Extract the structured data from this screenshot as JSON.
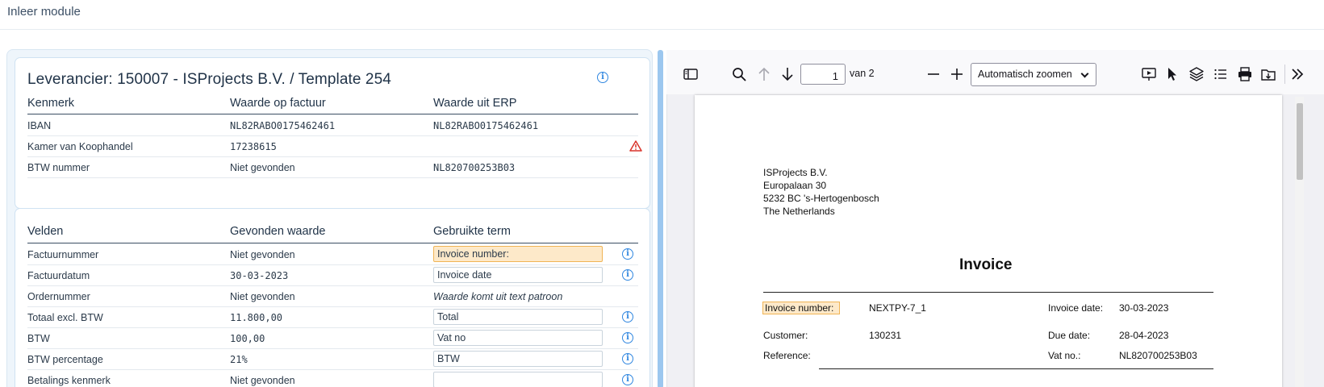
{
  "header": {
    "title": "Inleer module"
  },
  "supplier": {
    "title": "Leverancier: 150007 - ISProjects B.V. / Template 254",
    "columns": [
      "Kenmerk",
      "Waarde op factuur",
      "Waarde uit ERP"
    ],
    "rows": [
      {
        "label": "IBAN",
        "invoice": "NL82RABO0175462461",
        "erp": "NL82RABO0175462461",
        "warning": false
      },
      {
        "label": "Kamer van Koophandel",
        "invoice": "17238615",
        "erp": "",
        "warning": true
      },
      {
        "label": "BTW nummer",
        "invoice": "Niet gevonden",
        "erp": "NL820700253B03",
        "warning": false
      }
    ]
  },
  "fields": {
    "columns": [
      "Velden",
      "Gevonden waarde",
      "Gebruikte term"
    ],
    "rows": [
      {
        "label": "Factuurnummer",
        "found": "Niet gevonden",
        "term": "Invoice number:",
        "kind": "input",
        "active": true
      },
      {
        "label": "Factuurdatum",
        "found": "30-03-2023",
        "term": "Invoice date",
        "kind": "input",
        "active": false
      },
      {
        "label": "Ordernummer",
        "found": "Niet gevonden",
        "term": "Waarde komt uit text patroon",
        "kind": "text",
        "active": false
      },
      {
        "label": "Totaal excl. BTW",
        "found": "11.800,00",
        "term": "Total",
        "kind": "input",
        "active": false
      },
      {
        "label": "BTW",
        "found": "100,00",
        "term": "Vat no",
        "kind": "input",
        "active": false
      },
      {
        "label": "BTW percentage",
        "found": "21%",
        "term": "BTW",
        "kind": "input",
        "active": false
      },
      {
        "label": "Betalings kenmerk",
        "found": "Niet gevonden",
        "term": "",
        "kind": "input",
        "active": false
      }
    ]
  },
  "viewer": {
    "page": "1",
    "page_count": "van 2",
    "zoom": "Automatisch zoomen"
  },
  "invoice_doc": {
    "address": [
      "ISProjects B.V.",
      "Europalaan 30",
      "5232 BC 's-Hertogenbosch",
      "The Netherlands"
    ],
    "title": "Invoice",
    "invoice_number_label": "Invoice number:",
    "invoice_number": "NEXTPY-7_1",
    "invoice_date_label": "Invoice date:",
    "invoice_date": "30-03-2023",
    "customer_label": "Customer:",
    "customer": "130231",
    "due_date_label": "Due date:",
    "due_date": "28-04-2023",
    "reference_label": "Reference:",
    "vat_label": "Vat no.:",
    "vat": "NL820700253B03"
  },
  "colors": {
    "accent": "#2f86e0",
    "highlight": "#fde9c9",
    "highlight_border": "#f0b455",
    "warning": "#d9342b"
  }
}
